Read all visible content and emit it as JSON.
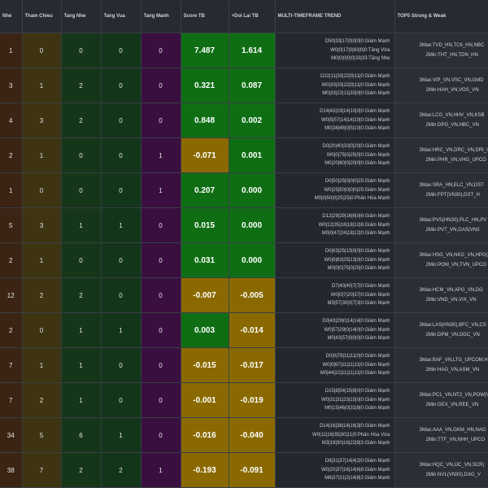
{
  "headers": [
    "Nhe",
    "Tham Chieu",
    "Tang Nhe",
    "Tang Vua",
    "Tang Manh",
    "Score TB",
    "+Doi Lai TB",
    "MULTI-TIMEFRAME TREND",
    "TOP5 Strong & Weak"
  ],
  "rows": [
    {
      "first": "1",
      "tham": "0",
      "nhe": "0",
      "vua": "0",
      "manh": "0",
      "score": "7.487",
      "score_sign": "pos",
      "doilai": "1.614",
      "doilai_sign": "pos",
      "trend": [
        "D50|33|17|0|0|0|0:Giảm Mạnh",
        "W0|0|17|0|83|0|0:Tăng Vừa",
        "M0|0|0|0|0|33|33:Tăng Nhẹ"
      ],
      "top5": [
        "3Max:TVD_HN,TC6_HN,NBC",
        "2Min:THT_HN,TDN_HN"
      ]
    },
    {
      "first": "3",
      "tham": "1",
      "nhe": "2",
      "vua": "0",
      "manh": "0",
      "score": "0.321",
      "score_sign": "pos",
      "doilai": "0.087",
      "doilai_sign": "pos",
      "trend": [
        "D22|11|33|22|0|11|0:Giảm Mạnh",
        "W0|33|33|22|0|11|0:Giảm Mạnh",
        "M0|33|22|11|33|0|0:Giảm Mạnh"
      ],
      "top5": [
        "3Max:VIP_VN,VSC_VN,GMD",
        "2Min:HAH_VN,VOS_VN"
      ]
    },
    {
      "first": "4",
      "tham": "3",
      "nhe": "2",
      "vua": "0",
      "manh": "0",
      "score": "0.848",
      "score_sign": "pos",
      "doilai": "0.002",
      "doilai_sign": "pos",
      "trend": [
        "D14|43|19|14|10|0|0:Giảm Mạnh",
        "W0|5|57|14|14|10|0:Giảm Mạnh",
        "M0|38|48|0|5|10|0:Giảm Mạnh"
      ],
      "top5": [
        "3Max:LCG_VN,HHV_VN,KSB",
        "2Min:DPG_VN,HBC_VN"
      ]
    },
    {
      "first": "2",
      "tham": "1",
      "nhe": "0",
      "vua": "0",
      "manh": "1",
      "score": "-0.071",
      "score_sign": "neg",
      "doilai": "0.001",
      "doilai_sign": "pos",
      "trend": [
        "D0|20|40|20|0|20|0:Giảm Mạnh",
        "W0|0|75|0|25|0|0:Giảm Mạnh",
        "M0|20|60|0|20|0|0:Giảm Mạnh"
      ],
      "top5": [
        "3Max:HRC_VN,DRC_VN,DRI_U",
        "2Min:PHR_VN,VHG_UPCO"
      ]
    },
    {
      "first": "1",
      "tham": "0",
      "nhe": "0",
      "vua": "0",
      "manh": "1",
      "score": "0.207",
      "score_sign": "pos",
      "doilai": "0.000",
      "doilai_sign": "pos",
      "trend": [
        "D0|50|25|0|0|0|25:Giảm Mạnh",
        "W0|25|50|0|0|0|25:Giảm Mạnh",
        "M0|0|50|0|25|25|0:Phân Hóa Mạnh"
      ],
      "top5": [
        "3Max:SRA_HN,ELC_VN,DST",
        "2Min:FPT(VN30),DST_H"
      ]
    },
    {
      "first": "5",
      "tham": "3",
      "nhe": "1",
      "vua": "1",
      "manh": "0",
      "score": "0.015",
      "score_sign": "pos",
      "doilai": "0.000",
      "doilai_sign": "pos",
      "trend": [
        "D12|29|29|16|6|0|6:Giảm Mạnh",
        "W0|12|35|18|18|12|6:Giảm Mạnh",
        "M0|0|47|24|18|12|0:Giảm Mạnh"
      ],
      "top5": [
        "3Max:PVS(HN30),PLC_HN,PV",
        "2Min:PVT_VN,GAS(VN3"
      ]
    },
    {
      "first": "2",
      "tham": "1",
      "nhe": "0",
      "vua": "0",
      "manh": "0",
      "score": "0.031",
      "score_sign": "pos",
      "doilai": "0.000",
      "doilai_sign": "pos",
      "trend": [
        "D0|63|25|13|0|0|0:Giảm Mạnh",
        "W0|0|63|25|13|0|0:Giảm Mạnh",
        "M0|0|0|75|0|25|0:Giảm Mạnh"
      ],
      "top5": [
        "3Max:HSG_VN,NKG_VN,HPG(",
        "2Min:POM_VN,TVN_UPCO"
      ]
    },
    {
      "first": "12",
      "tham": "2",
      "nhe": "2",
      "vua": "0",
      "manh": "0",
      "score": "-0.007",
      "score_sign": "neg",
      "doilai": "-0.005",
      "doilai_sign": "neg",
      "trend": [
        "D7|40|40|7|7|0:Giảm Mạnh",
        "W0|0|7|20|37|0:Giảm Mạnh",
        "M3|57|30|0|7|3|0:Giảm Mạnh"
      ],
      "top5": [
        "3Max:HCM_VN,APG_VN,DG",
        "2Min:VND_VN,VIX_VN"
      ]
    },
    {
      "first": "2",
      "tham": "0",
      "nhe": "1",
      "vua": "1",
      "manh": "0",
      "score": "0.003",
      "score_sign": "pos",
      "doilai": "-0.014",
      "doilai_sign": "neg",
      "trend": [
        "D0|43|29|0|14|14|0:Giảm Mạnh",
        "W0|57|29|0|14|0|0:Giảm Mạnh",
        "M0|43|57|0|0|0|0:Giảm Mạnh"
      ],
      "top5": [
        "3Max:LAS(HN30),BFC_VN,CS",
        "2Min:DPM_VN,DGC_VN"
      ]
    },
    {
      "first": "7",
      "tham": "1",
      "nhe": "1",
      "vua": "0",
      "manh": "0",
      "score": "-0.015",
      "score_sign": "neg",
      "doilai": "-0.017",
      "doilai_sign": "neg",
      "trend": [
        "D0|0|78|11|11|0|0:Giảm Mạnh",
        "W0|0|67|11|11|11|0:Giảm Mạnh",
        "M0|44|22|11|11|11|0:Giảm Mạnh"
      ],
      "top5": [
        "3Max:BAF_VN,LTG_UPCOM,HN",
        "2Min:HAG_VN,ASM_VN"
      ]
    },
    {
      "first": "7",
      "tham": "2",
      "nhe": "1",
      "vua": "0",
      "manh": "0",
      "score": "-0.001",
      "score_sign": "neg",
      "doilai": "-0.019",
      "doilai_sign": "neg",
      "trend": [
        "D15|8|54|15|8|0|0:Giảm Mạnh",
        "W0|31|31|23|15|0|0:Giảm Mạnh",
        "M0|15|46|0|31|8|0:Giảm Mạnh"
      ],
      "top5": [
        "3Max:PC1_VN,NT2_VN,POW(V",
        "2Min:GEX_VN,REE_VN"
      ]
    },
    {
      "first": "34",
      "tham": "5",
      "nhe": "6",
      "vua": "1",
      "manh": "0",
      "score": "-0.016",
      "score_sign": "neg",
      "doilai": "-0.040",
      "doilai_sign": "neg",
      "trend": [
        "D14|16|38|14|16|3|0:Giảm Mạnh",
        "W0|11|16|35|30|11|0:Phân Hóa Vừa",
        "M3|19|30|16|22|8|3:Giảm Mạnh"
      ],
      "top5": [
        "3Max:AAA_VN,GKM_HN,NAG",
        "2Min:TTF_VN,NHH_UPCO"
      ]
    },
    {
      "first": "38",
      "tham": "7",
      "nhe": "2",
      "vua": "2",
      "manh": "1",
      "score": "-0.193",
      "score_sign": "neg",
      "doilai": "-0.091",
      "doilai_sign": "neg",
      "trend": [
        "D8|31|37|14|4|2|0:Giảm Mạnh",
        "W0|20|37|16|14|6|8:Giảm Mạnh",
        "M6|37|31|2|14|8|2:Giảm Mạnh"
      ],
      "top5": [
        "3Max:HQC_VN,IJC_VN,SCR(",
        "2Min:NVL(VN30),DXG_V"
      ]
    }
  ]
}
